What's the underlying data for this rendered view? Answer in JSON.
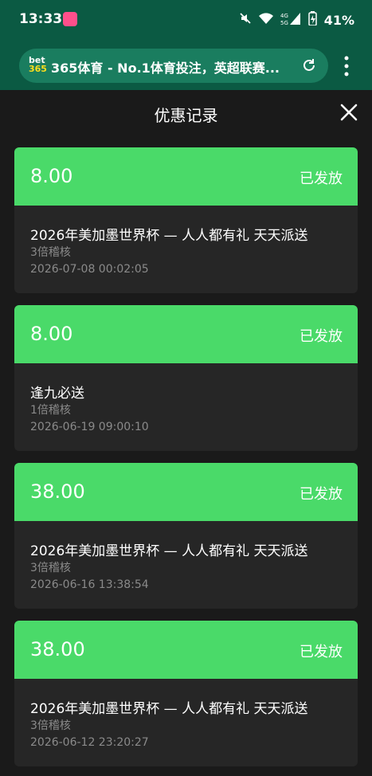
{
  "status_bar": {
    "time": "13:33",
    "battery": "41%",
    "network_label_1": "4G",
    "network_label_2": "5G"
  },
  "browser": {
    "logo_top": "bet",
    "logo_bottom": "365",
    "page_title": "365体育 - No.1体育投注，英超联赛...",
    "reload_icon": "reload-icon",
    "menu_icon": "more-vertical-icon"
  },
  "header": {
    "title": "优惠记录",
    "close_icon": "close-icon"
  },
  "colors": {
    "record_header_green": "#4ada69",
    "card_bg": "#262626",
    "page_bg": "#1a1a1a",
    "browser_bar": "#0b5a43"
  },
  "records": [
    {
      "amount": "8.00",
      "status": "已发放",
      "name": "2026年美加墨世界杯 — 人人都有礼 天天派送",
      "multiplier": "3倍稽核",
      "date": "2026-07-08 00:02:05"
    },
    {
      "amount": "8.00",
      "status": "已发放",
      "name": "逢九必送",
      "multiplier": "1倍稽核",
      "date": "2026-06-19 09:00:10"
    },
    {
      "amount": "38.00",
      "status": "已发放",
      "name": "2026年美加墨世界杯 — 人人都有礼 天天派送",
      "multiplier": "3倍稽核",
      "date": "2026-06-16 13:38:54"
    },
    {
      "amount": "38.00",
      "status": "已发放",
      "name": "2026年美加墨世界杯 — 人人都有礼 天天派送",
      "multiplier": "3倍稽核",
      "date": "2026-06-12 23:20:27"
    }
  ]
}
